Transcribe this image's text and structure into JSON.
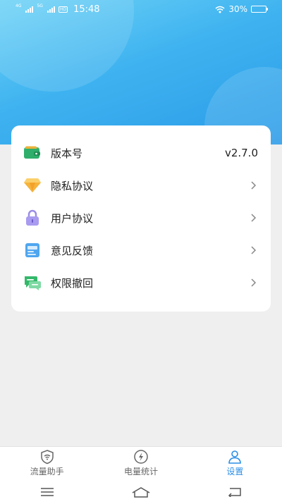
{
  "status_bar": {
    "network_1": "4G",
    "network_2": "5G",
    "hd": "HD",
    "time": "15:48",
    "battery": "30%"
  },
  "settings": {
    "items": [
      {
        "label": "版本号",
        "value": "v2.7.0",
        "icon": "wallet-icon"
      },
      {
        "label": "隐私协议",
        "icon": "diamond-icon"
      },
      {
        "label": "用户协议",
        "icon": "lock-icon"
      },
      {
        "label": "意见反馈",
        "icon": "feedback-card-icon"
      },
      {
        "label": "权限撤回",
        "icon": "chat-bubbles-icon"
      }
    ]
  },
  "tabbar": {
    "tabs": [
      {
        "label": "流量助手",
        "icon": "wifi-shield-icon"
      },
      {
        "label": "电量统计",
        "icon": "charge-icon"
      },
      {
        "label": "设置",
        "icon": "user-icon",
        "active": true
      }
    ]
  },
  "colors": {
    "header_gradient_start": "#6fd3f6",
    "header_gradient_end": "#2a9be8",
    "active_tab": "#2a8ee6",
    "page_background": "#efefef"
  }
}
